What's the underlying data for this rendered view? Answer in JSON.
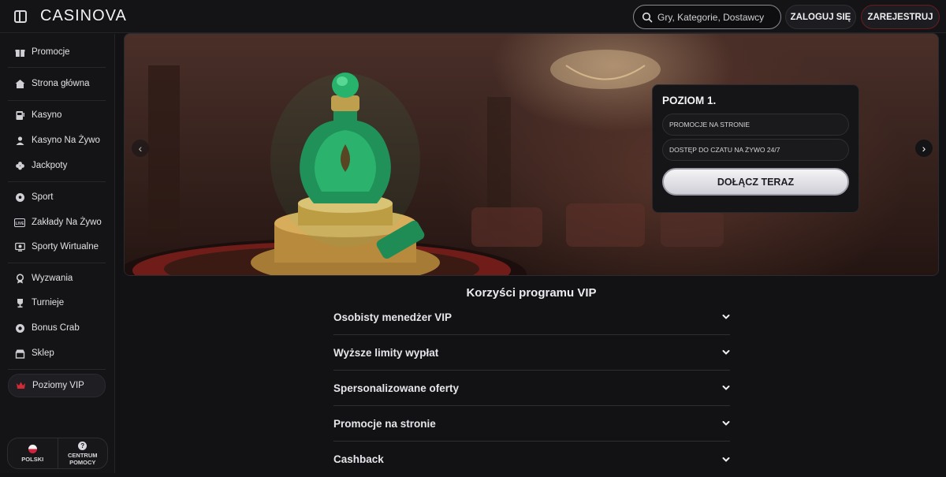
{
  "header": {
    "logo": "CASINOVA",
    "search_placeholder": "Gry, Kategorie, Dostawcy",
    "login_label": "ZALOGUJ SIĘ",
    "register_label": "ZAREJESTRUJ"
  },
  "sidebar": {
    "items": [
      {
        "label": "Promocje",
        "icon": "gift-icon"
      },
      {
        "label": "Strona główna",
        "icon": "home-icon"
      },
      {
        "label": "Kasyno",
        "icon": "slot-machine-icon"
      },
      {
        "label": "Kasyno Na Żywo",
        "icon": "dealer-icon"
      },
      {
        "label": "Jackpoty",
        "icon": "clover-icon"
      },
      {
        "label": "Sport",
        "icon": "soccer-ball-icon"
      },
      {
        "label": "Zakłady Na Żywo",
        "icon": "live-icon"
      },
      {
        "label": "Sporty Wirtualne",
        "icon": "virtual-sports-icon"
      },
      {
        "label": "Wyzwania",
        "icon": "medal-icon"
      },
      {
        "label": "Turnieje",
        "icon": "trophy-icon"
      },
      {
        "label": "Bonus Crab",
        "icon": "crab-icon"
      },
      {
        "label": "Sklep",
        "icon": "shop-icon"
      },
      {
        "label": "Poziomy VIP",
        "icon": "crown-icon"
      }
    ],
    "language_label": "POLSKI",
    "help_label_1": "CENTRUM",
    "help_label_2": "POMOCY"
  },
  "hero": {
    "level_title": "POZIOM 1.",
    "perks": [
      "PROMOCJE NA STRONIE",
      "DOSTĘP DO CZATU NA ŻYWO 24/7"
    ],
    "join_label": "DOŁĄCZ TERAZ"
  },
  "benefits": {
    "title": "Korzyści programu VIP",
    "items": [
      "Osobisty menedżer VIP",
      "Wyższe limity wypłat",
      "Spersonalizowane oferty",
      "Promocje na stronie",
      "Cashback"
    ]
  },
  "colors": {
    "accent_red": "#d02a36",
    "background": "#121215"
  }
}
